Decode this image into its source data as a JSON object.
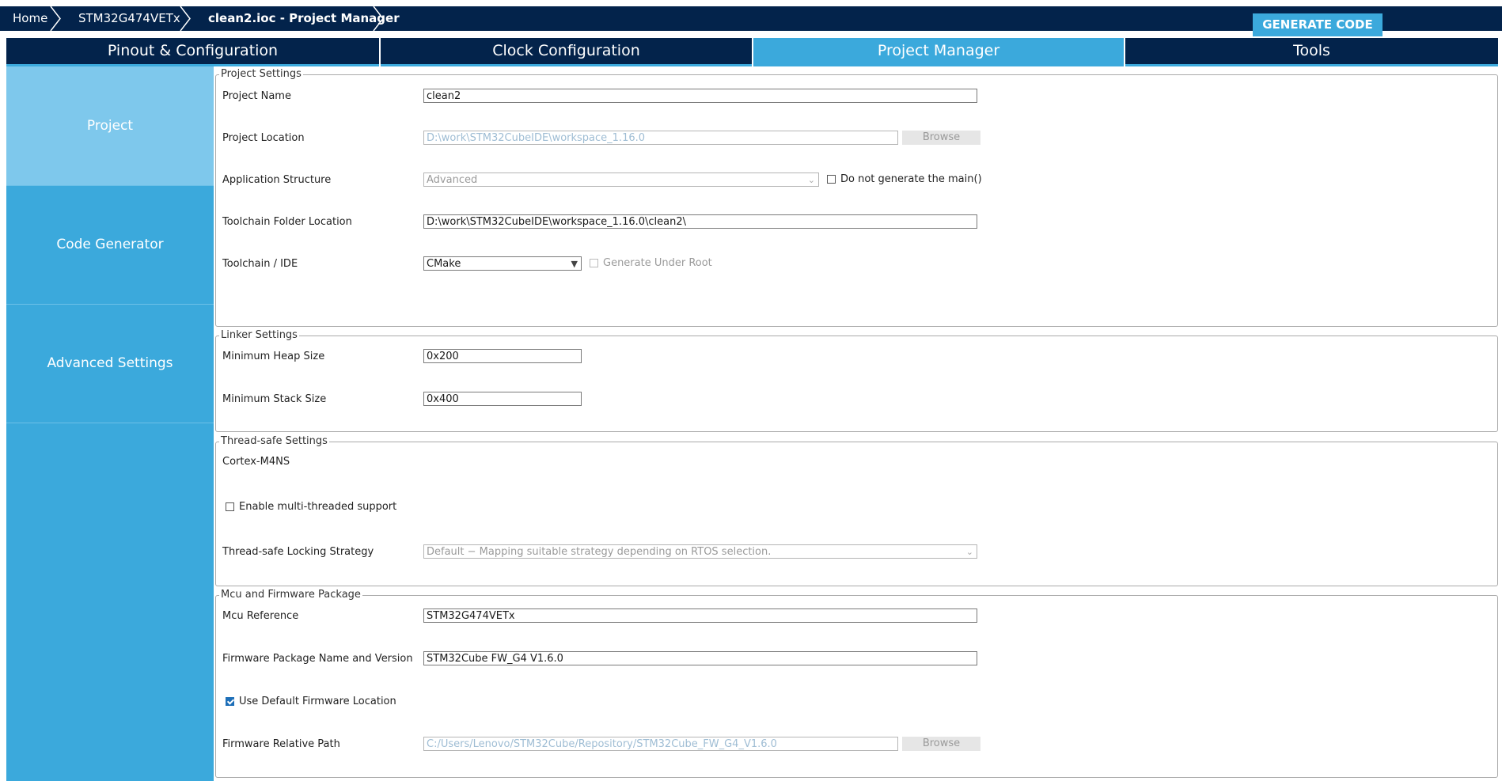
{
  "breadcrumb": {
    "home": "Home",
    "mcu": "STM32G474VETx",
    "current": "clean2.ioc - Project Manager"
  },
  "generate_button": "GENERATE CODE",
  "tabs": [
    {
      "label": "Pinout & Configuration"
    },
    {
      "label": "Clock Configuration"
    },
    {
      "label": "Project Manager"
    },
    {
      "label": "Tools"
    }
  ],
  "sidebar": {
    "items": [
      {
        "label": "Project"
      },
      {
        "label": "Code Generator"
      },
      {
        "label": "Advanced Settings"
      }
    ]
  },
  "project_settings": {
    "legend": "Project Settings",
    "project_name_label": "Project Name",
    "project_name_value": "clean2",
    "project_location_label": "Project Location",
    "project_location_value": "D:\\work\\STM32CubeIDE\\workspace_1.16.0",
    "browse_label": "Browse",
    "app_structure_label": "Application Structure",
    "app_structure_value": "Advanced",
    "no_main_label": "Do not generate the main()",
    "toolchain_folder_label": "Toolchain Folder Location",
    "toolchain_folder_value": "D:\\work\\STM32CubeIDE\\workspace_1.16.0\\clean2\\",
    "toolchain_ide_label": "Toolchain / IDE",
    "toolchain_ide_value": "CMake",
    "generate_under_root_label": "Generate Under Root"
  },
  "linker_settings": {
    "legend": "Linker Settings",
    "heap_label": "Minimum Heap Size",
    "heap_value": "0x200",
    "stack_label": "Minimum Stack Size",
    "stack_value": "0x400"
  },
  "thread_safe_settings": {
    "legend": "Thread-safe Settings",
    "core": "Cortex-M4NS",
    "multi_thread_label": "Enable multi-threaded support",
    "locking_label": "Thread-safe Locking Strategy",
    "locking_value": "Default  −  Mapping suitable strategy depending on RTOS selection."
  },
  "mcu_firmware": {
    "legend": "Mcu and Firmware Package",
    "mcu_ref_label": "Mcu Reference",
    "mcu_ref_value": "STM32G474VETx",
    "fw_name_label": "Firmware Package Name and Version",
    "fw_name_value": "STM32Cube FW_G4 V1.6.0",
    "use_default_label": "Use Default Firmware Location",
    "fw_path_label": "Firmware Relative Path",
    "fw_path_value": "C:/Users/Lenovo/STM32Cube/Repository/STM32Cube_FW_G4_V1.6.0",
    "browse_label": "Browse"
  },
  "colors": {
    "navy": "#03234b",
    "accent": "#3ba9dc",
    "sidebar_active": "#7ec8ec"
  }
}
